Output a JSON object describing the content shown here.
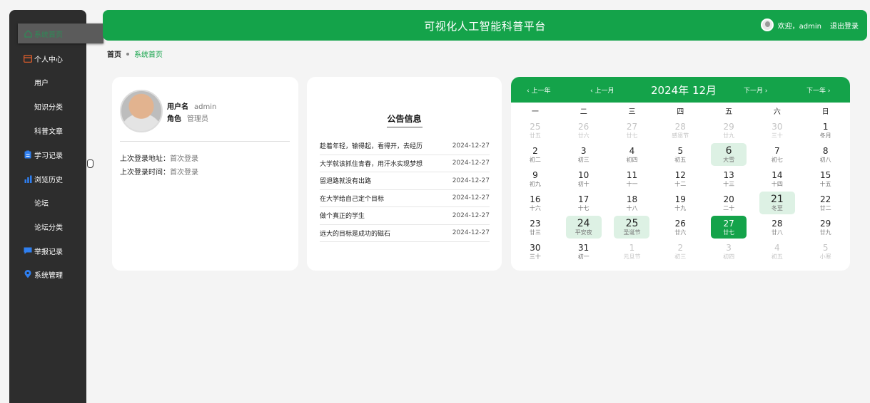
{
  "sidebar": {
    "items": [
      {
        "label": "系统首页",
        "icon": "home-icon",
        "active": true
      },
      {
        "label": "个人中心",
        "icon": "profile-card-icon"
      },
      {
        "label": "用户",
        "icon": "grid-icon"
      },
      {
        "label": "知识分类",
        "icon": "grid-icon"
      },
      {
        "label": "科普文章",
        "icon": "grid-icon"
      },
      {
        "label": "学习记录",
        "icon": "clipboard-icon"
      },
      {
        "label": "浏览历史",
        "icon": "bar-chart-icon"
      },
      {
        "label": "论坛",
        "icon": "grid-icon"
      },
      {
        "label": "论坛分类",
        "icon": "grid-icon"
      },
      {
        "label": "举报记录",
        "icon": "comment-icon"
      },
      {
        "label": "系统管理",
        "icon": "location-pin-icon"
      }
    ]
  },
  "header": {
    "title": "可视化人工智能科普平台",
    "welcome": "欢迎，admin",
    "logout": "退出登录"
  },
  "breadcrumb": {
    "home": "首页",
    "current": "系统首页"
  },
  "user_card": {
    "username_label": "用户名",
    "username": "admin",
    "role_label": "角色",
    "role": "管理员",
    "last_login_addr_label": "上次登录地址：",
    "last_login_addr": "首次登录",
    "last_login_time_label": "上次登录时间：",
    "last_login_time": "首次登录"
  },
  "notice": {
    "title": "公告信息",
    "items": [
      {
        "text": "趁着年轻，输得起，看得开，去经历",
        "date": "2024-12-27"
      },
      {
        "text": "大学就该抓住青春，用汗水实现梦想",
        "date": "2024-12-27"
      },
      {
        "text": "留退路就没有出路",
        "date": "2024-12-27"
      },
      {
        "text": "在大学给自己定个目标",
        "date": "2024-12-27"
      },
      {
        "text": "做个真正的学生",
        "date": "2024-12-27"
      },
      {
        "text": "远大的目标是成功的磁石",
        "date": "2024-12-27"
      }
    ]
  },
  "calendar": {
    "prev_year": "‹ 上一年",
    "prev_month": "‹ 上一月",
    "month": "2024年 12月",
    "next_month": "下一月 ›",
    "next_year": "下一年 ›",
    "weekdays": [
      "一",
      "二",
      "三",
      "四",
      "五",
      "六",
      "日"
    ],
    "weeks": [
      [
        {
          "n": "25",
          "l": "廿五",
          "dim": true
        },
        {
          "n": "26",
          "l": "廿六",
          "dim": true
        },
        {
          "n": "27",
          "l": "廿七",
          "dim": true
        },
        {
          "n": "28",
          "l": "感恩节",
          "dim": true
        },
        {
          "n": "29",
          "l": "廿九",
          "dim": true
        },
        {
          "n": "30",
          "l": "三十",
          "dim": true
        },
        {
          "n": "1",
          "l": "冬月"
        }
      ],
      [
        {
          "n": "2",
          "l": "初二"
        },
        {
          "n": "3",
          "l": "初三"
        },
        {
          "n": "4",
          "l": "初四"
        },
        {
          "n": "5",
          "l": "初五"
        },
        {
          "n": "6",
          "l": "大雪",
          "fest": true
        },
        {
          "n": "7",
          "l": "初七"
        },
        {
          "n": "8",
          "l": "初八"
        }
      ],
      [
        {
          "n": "9",
          "l": "初九"
        },
        {
          "n": "10",
          "l": "初十"
        },
        {
          "n": "11",
          "l": "十一"
        },
        {
          "n": "12",
          "l": "十二"
        },
        {
          "n": "13",
          "l": "十三"
        },
        {
          "n": "14",
          "l": "十四"
        },
        {
          "n": "15",
          "l": "十五"
        }
      ],
      [
        {
          "n": "16",
          "l": "十六"
        },
        {
          "n": "17",
          "l": "十七"
        },
        {
          "n": "18",
          "l": "十八"
        },
        {
          "n": "19",
          "l": "十九"
        },
        {
          "n": "20",
          "l": "二十"
        },
        {
          "n": "21",
          "l": "冬至",
          "fest": true
        },
        {
          "n": "22",
          "l": "廿二"
        }
      ],
      [
        {
          "n": "23",
          "l": "廿三"
        },
        {
          "n": "24",
          "l": "平安夜",
          "fest": true
        },
        {
          "n": "25",
          "l": "圣诞节",
          "fest": true
        },
        {
          "n": "26",
          "l": "廿六"
        },
        {
          "n": "27",
          "l": "廿七",
          "today": true
        },
        {
          "n": "28",
          "l": "廿八"
        },
        {
          "n": "29",
          "l": "廿九"
        }
      ],
      [
        {
          "n": "30",
          "l": "三十"
        },
        {
          "n": "31",
          "l": "初一"
        },
        {
          "n": "1",
          "l": "元旦节",
          "dim": true
        },
        {
          "n": "2",
          "l": "初三",
          "dim": true
        },
        {
          "n": "3",
          "l": "初四",
          "dim": true
        },
        {
          "n": "4",
          "l": "初五",
          "dim": true
        },
        {
          "n": "5",
          "l": "小寒",
          "dim": true
        }
      ]
    ]
  },
  "colors": {
    "primary": "#14a34a",
    "sidebar_bg": "#2d2d2d",
    "icon_blue": "#2f7ff0",
    "profile_orange": "#e8602c",
    "festival_bg": "#ddf1e4"
  }
}
